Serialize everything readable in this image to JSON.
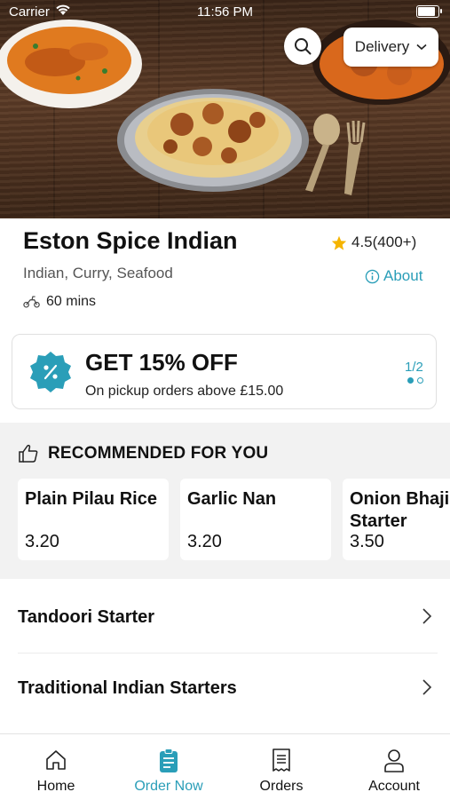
{
  "status_bar": {
    "carrier": "Carrier",
    "time": "11:56 PM",
    "battery_level": 0.95
  },
  "header": {
    "delivery_label": "Delivery",
    "search_icon": "search-icon"
  },
  "restaurant": {
    "name": "Eston Spice Indian",
    "rating": "4.5(400+)",
    "cuisine": "Indian, Curry, Seafood",
    "about_label": "About",
    "delivery_time": "60 mins"
  },
  "promo": {
    "title": "GET 15% OFF",
    "subtitle": "On pickup orders above £15.00",
    "page_indicator": "1/2",
    "current_page": 1,
    "total_pages": 2
  },
  "recommended": {
    "heading": "RECOMMENDED FOR YOU",
    "items": [
      {
        "name": "Plain Pilau Rice",
        "price": "3.20"
      },
      {
        "name": "Garlic Nan",
        "price": "3.20"
      },
      {
        "name": "Onion Bhaji Starter",
        "price": "3.50"
      }
    ]
  },
  "categories": [
    {
      "label": "Tandoori Starter"
    },
    {
      "label": "Traditional Indian Starters"
    }
  ],
  "tabs": [
    {
      "label": "Home",
      "icon": "home-icon",
      "active": false
    },
    {
      "label": "Order Now",
      "icon": "order-icon",
      "active": true
    },
    {
      "label": "Orders",
      "icon": "receipt-icon",
      "active": false
    },
    {
      "label": "Account",
      "icon": "user-icon",
      "active": false
    }
  ],
  "colors": {
    "accent": "#2a9eb8",
    "star": "#f5b400",
    "text": "#111111",
    "section_bg": "#f2f2f2"
  }
}
